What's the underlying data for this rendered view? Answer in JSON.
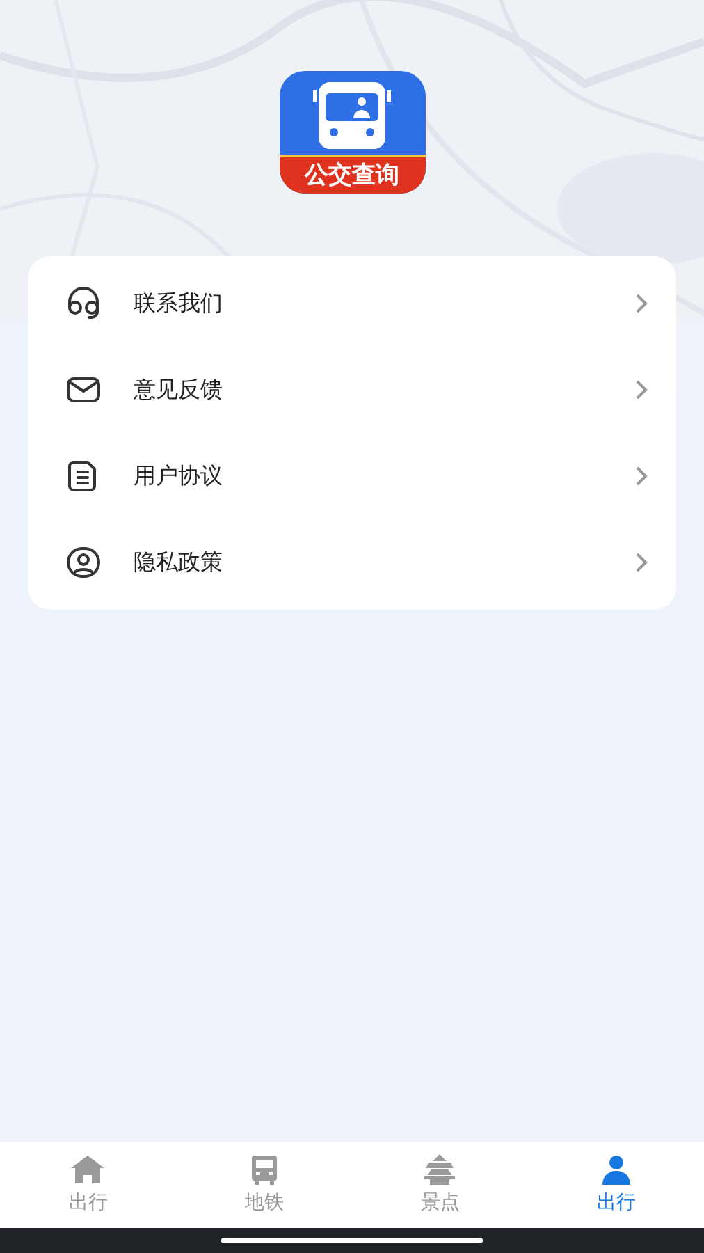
{
  "app_logo": {
    "label": "公交查询"
  },
  "menu": [
    {
      "kind": "headset",
      "label": "联系我们"
    },
    {
      "kind": "mail",
      "label": "意见反馈"
    },
    {
      "kind": "document",
      "label": "用户协议"
    },
    {
      "kind": "privacy",
      "label": "隐私政策"
    }
  ],
  "tabs": [
    {
      "kind": "home",
      "label": "出行",
      "selected": false
    },
    {
      "kind": "bus",
      "label": "地铁",
      "selected": false
    },
    {
      "kind": "pagoda",
      "label": "景点",
      "selected": false
    },
    {
      "kind": "person",
      "label": "出行",
      "selected": true
    }
  ]
}
